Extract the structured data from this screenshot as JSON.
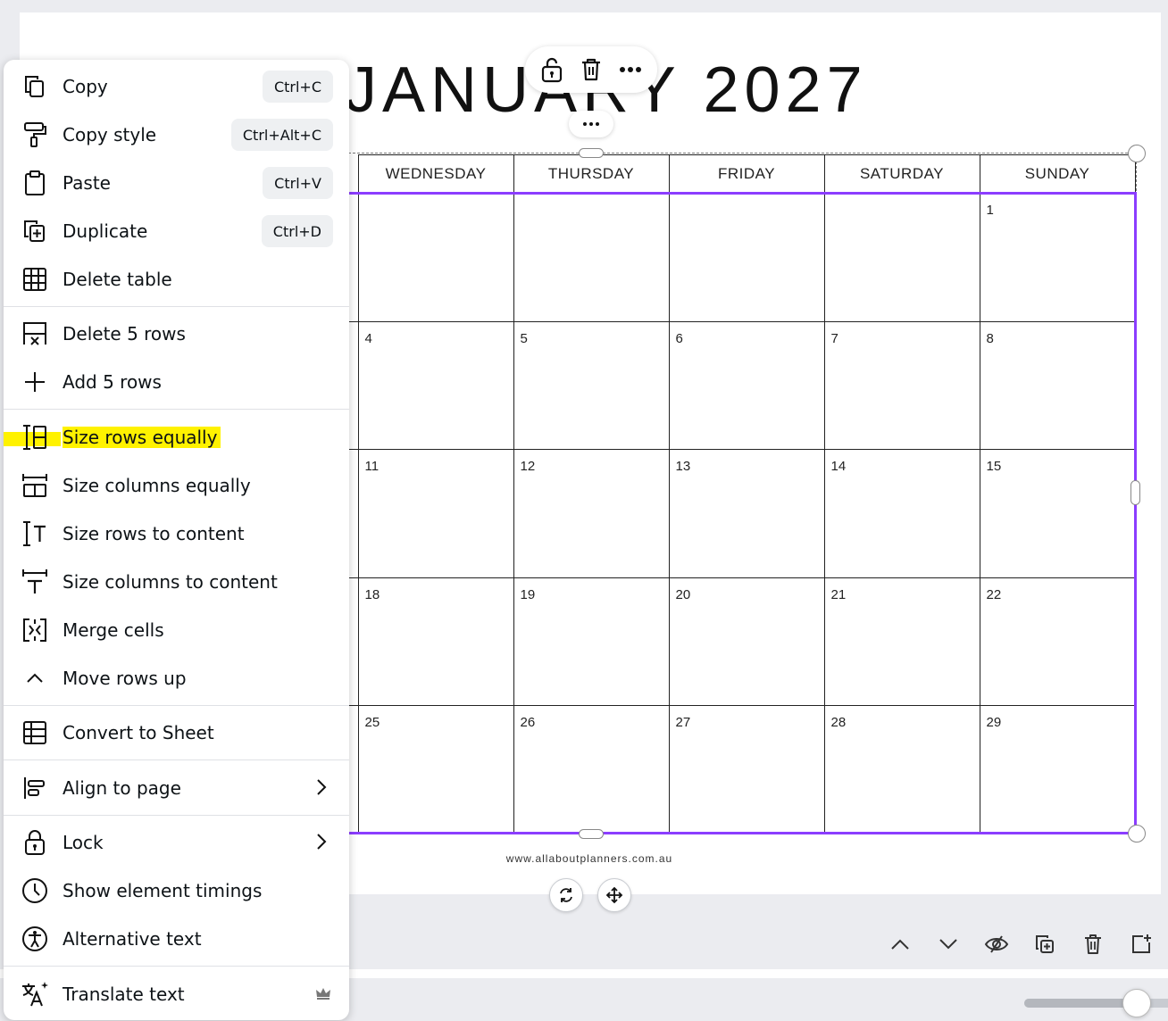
{
  "canvas": {
    "title": "JANUARY 2027",
    "footer_url": "www.allaboutplanners.com.au"
  },
  "calendar": {
    "headers": [
      "",
      "WEDNESDAY",
      "THURSDAY",
      "FRIDAY",
      "SATURDAY",
      "SUNDAY"
    ],
    "rows": [
      [
        "",
        "",
        "",
        "",
        "",
        "1"
      ],
      [
        "",
        "4",
        "5",
        "6",
        "7",
        "8"
      ],
      [
        "",
        "11",
        "12",
        "13",
        "14",
        "15"
      ],
      [
        "",
        "18",
        "19",
        "20",
        "21",
        "22"
      ],
      [
        "",
        "25",
        "26",
        "27",
        "28",
        "29"
      ]
    ]
  },
  "context_menu": {
    "items": [
      {
        "label": "Copy",
        "shortcut": "Ctrl+C",
        "icon": "copy-icon"
      },
      {
        "label": "Copy style",
        "shortcut": "Ctrl+Alt+C",
        "icon": "paint-roller-icon"
      },
      {
        "label": "Paste",
        "shortcut": "Ctrl+V",
        "icon": "clipboard-icon"
      },
      {
        "label": "Duplicate",
        "shortcut": "Ctrl+D",
        "icon": "duplicate-icon"
      },
      {
        "label": "Delete table",
        "icon": "table-icon"
      },
      {
        "label": "Delete 5 rows",
        "icon": "delete-rows-icon"
      },
      {
        "label": "Add 5 rows",
        "icon": "plus-icon"
      },
      {
        "label": "Size rows equally",
        "icon": "size-rows-equally-icon",
        "highlighted": true
      },
      {
        "label": "Size columns equally",
        "icon": "size-columns-equally-icon"
      },
      {
        "label": "Size rows to content",
        "icon": "size-rows-content-icon"
      },
      {
        "label": "Size columns to content",
        "icon": "size-columns-content-icon"
      },
      {
        "label": "Merge cells",
        "icon": "merge-cells-icon"
      },
      {
        "label": "Move rows up",
        "icon": "chevron-up-icon"
      },
      {
        "label": "Convert to Sheet",
        "icon": "sheet-icon"
      },
      {
        "label": "Align to page",
        "icon": "align-icon",
        "submenu": true
      },
      {
        "label": "Lock",
        "icon": "lock-icon",
        "submenu": true
      },
      {
        "label": "Show element timings",
        "icon": "clock-icon"
      },
      {
        "label": "Alternative text",
        "icon": "accessibility-icon"
      },
      {
        "label": "Translate text",
        "icon": "translate-icon",
        "premium": true
      }
    ]
  },
  "colors": {
    "selection": "#8b3dff",
    "highlight": "#fff200",
    "background": "#ebecf0"
  }
}
